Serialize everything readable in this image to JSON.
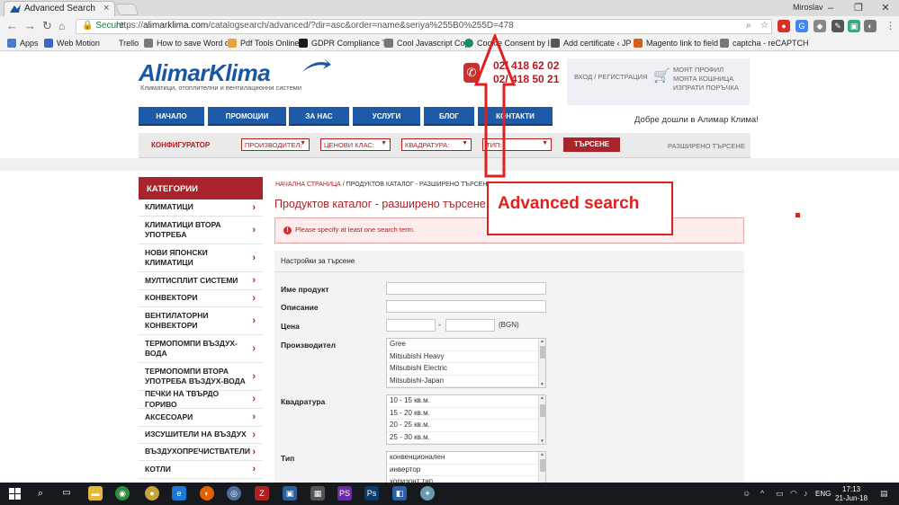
{
  "browser": {
    "tab_title": "Advanced Search",
    "window_user": "Miroslav",
    "secure_label": "Secure",
    "url_scheme": "https://",
    "url_host": "alimarklima.com",
    "url_path": "/catalogsearch/advanced/?dir=asc&order=name&seriya%255B0%255D=478"
  },
  "bookmarks": [
    {
      "label": "Apps",
      "color": "#4a7bd0"
    },
    {
      "label": "Web Motion",
      "color": "#3a66c4"
    },
    {
      "label": "Trello",
      "color": "#0079bf"
    },
    {
      "label": "How to save Word d",
      "color": "#7a7a7a"
    },
    {
      "label": "Pdf Tools Online",
      "color": "#e8a33a"
    },
    {
      "label": "GDPR Compliance T",
      "color": "#1a1a1a"
    },
    {
      "label": "Cool Javascript Cop",
      "color": "#777777"
    },
    {
      "label": "Cookie Consent by I",
      "color": "#1b8a6b"
    },
    {
      "label": "Add certificate ‹ JP",
      "color": "#555555"
    },
    {
      "label": "Magento link to field",
      "color": "#d0601c"
    },
    {
      "label": "captcha - reCAPTCH",
      "color": "#777777"
    }
  ],
  "site": {
    "logo": "AlimarKlima",
    "logo_sub": "Климатици, отоплителни и вентилационни системи",
    "phone1": "02/ 418 62 02",
    "phone2": "02/ 418 50 21",
    "login": "ВХОД / РЕГИСТРАЦИЯ",
    "cart": [
      "МОЯТ ПРОФИЛ",
      "МОЯТА КОШНИЦА",
      "ИЗПРАТИ ПОРЪЧКА"
    ],
    "nav": [
      "НАЧАЛО",
      "ПРОМОЦИИ",
      "ЗА НАС",
      "УСЛУГИ",
      "БЛОГ",
      "КОНТАКТИ"
    ],
    "welcome": "Добре дошли в Алимар Клима!"
  },
  "filter": {
    "configurator": "КОНФИГУРАТОР",
    "selects": [
      "ПРОИЗВОДИТЕЛ:",
      "ЦЕНОВИ КЛАС:",
      "КВАДРАТУРА:",
      "ТИП:"
    ],
    "search": "ТЪРСЕНЕ",
    "advanced": "РАЗШИРЕНО ТЪРСЕНЕ"
  },
  "sidebar": {
    "title": "КАТЕГОРИИ",
    "items": [
      "КЛИМАТИЦИ",
      "КЛИМАТИЦИ ВТОРА УПОТРЕБА",
      "НОВИ ЯПОНСКИ КЛИМАТИЦИ",
      "МУЛТИСПЛИТ СИСТЕМИ",
      "КОНВЕКТОРИ",
      "ВЕНТИЛАТОРНИ КОНВЕКТОРИ",
      "ТЕРМОПОМПИ ВЪЗДУХ-ВОДА",
      "ТЕРМОПОМПИ ВТОРА УПОТРЕБА ВЪЗДУХ-ВОДА",
      "ПЕЧКИ НА ТВЪРДО ГОРИВО",
      "АКСЕСОАРИ",
      "ИЗСУШИТЕЛИ НА ВЪЗДУХ",
      "ВЪЗДУХОПРЕЧИСТВАТЕЛИ",
      "КОТЛИ"
    ]
  },
  "main": {
    "breadcrumb_home": "НАЧАЛНА СТРАНИЦА",
    "breadcrumb_sep": " / ",
    "breadcrumb_current": "ПРОДУКТОВ КАТАЛОГ - РАЗШИРЕНО ТЪРСЕНЕ",
    "title": "Продуктов каталог - разширено търсене",
    "error": "Please specify at least one search term.",
    "panel_title": "Настройки за търсене",
    "labels": {
      "name": "Име продукт",
      "description": "Описание",
      "price": "Цена",
      "price_sep": "-",
      "currency": "(BGN)",
      "manufacturer": "Производител",
      "area": "Квадратура",
      "type": "Тип"
    },
    "manufacturers": [
      "Gree",
      "Mitsubishi Heavy",
      "Mitsubishi Electric",
      "Mitsubishi-Japan"
    ],
    "areas": [
      "10 - 15 кв.м.",
      "15 - 20 кв.м.",
      "20 - 25 кв.м.",
      "25 - 30 кв.м."
    ],
    "types": [
      "конвенционален",
      "инвертор",
      "хоризонт тип"
    ]
  },
  "annotation": {
    "text": "Advanced search",
    "color": "#e02020"
  },
  "taskbar": {
    "lang": "ENG",
    "time": "17:13",
    "date": "21-Jun-18"
  }
}
